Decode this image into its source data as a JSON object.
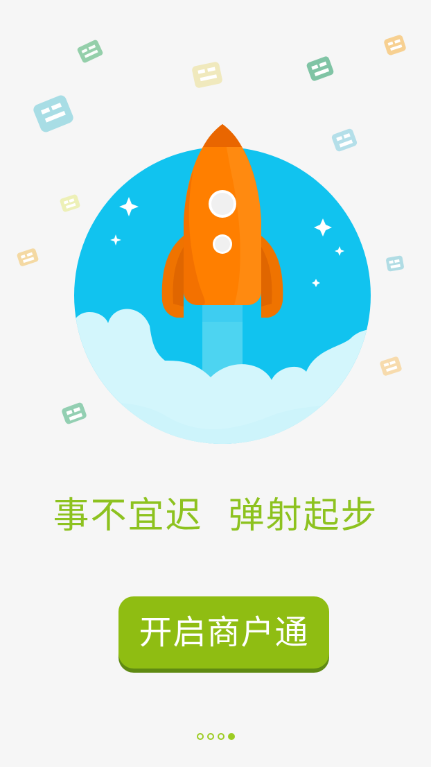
{
  "screen": {
    "tagline": "事不宜迟  弹射起步",
    "cta_label": "开启商户通",
    "page_indicator": {
      "total": 4,
      "active": 4
    }
  },
  "colors": {
    "background": "#f6f6f6",
    "accent_green": "#8dc21f",
    "button_green": "#8fbd12",
    "sky_blue": "#11c3ef",
    "cloud": "#d2f5fb",
    "rocket_orange": "#ff7f00",
    "rocket_dark": "#ea6a00"
  },
  "icons": {
    "hero": "rocket-launch-illustration",
    "watermarks": "watermark-logo"
  }
}
